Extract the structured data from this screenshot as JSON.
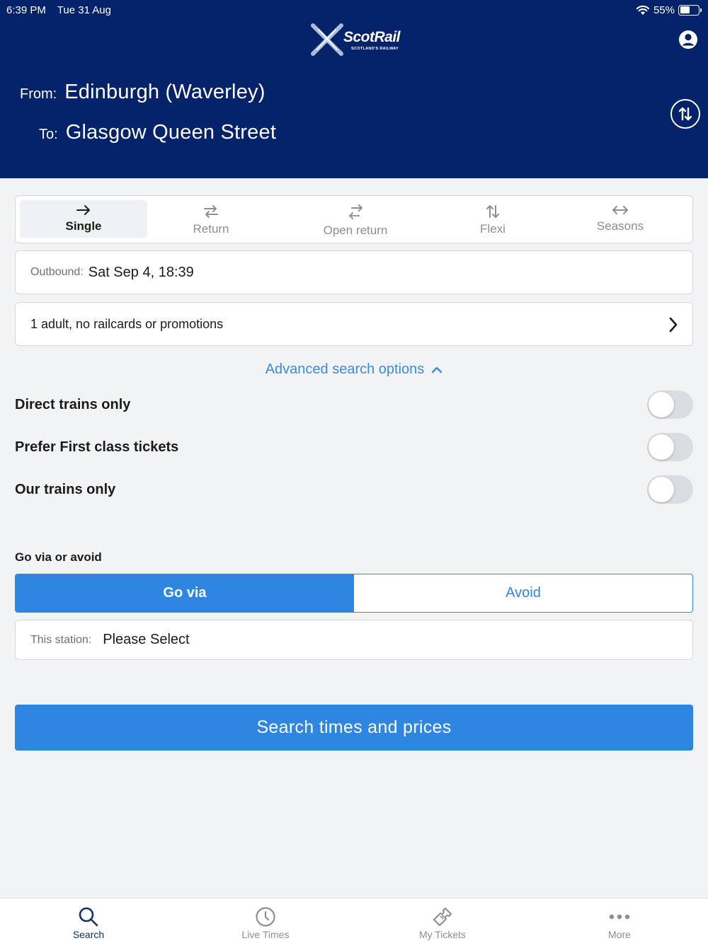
{
  "status_bar": {
    "time": "6:39 PM",
    "date": "Tue 31 Aug",
    "battery": "55%",
    "battery_level": 0.55
  },
  "brand": {
    "name": "ScotRail",
    "tagline": "SCOTLAND'S RAILWAY"
  },
  "journey": {
    "from_label": "From:",
    "from_value": "Edinburgh (Waverley)",
    "to_label": "To:",
    "to_value": "Glasgow Queen Street"
  },
  "ticket_types": [
    {
      "label": "Single",
      "icon": "arrow-right-icon",
      "active": true
    },
    {
      "label": "Return",
      "icon": "arrows-exchange-icon",
      "active": false
    },
    {
      "label": "Open return",
      "icon": "open-return-icon",
      "active": false
    },
    {
      "label": "Flexi",
      "icon": "arrows-up-down-icon",
      "active": false
    },
    {
      "label": "Seasons",
      "icon": "arrow-left-right-icon",
      "active": false
    }
  ],
  "outbound": {
    "label": "Outbound:",
    "value": "Sat Sep 4, 18:39"
  },
  "passengers": {
    "value": "1 adult, no railcards or promotions"
  },
  "advanced": {
    "label": "Advanced search options"
  },
  "toggles": [
    {
      "label": "Direct trains only",
      "on": false
    },
    {
      "label": "Prefer First class tickets",
      "on": false
    },
    {
      "label": "Our trains only",
      "on": false
    }
  ],
  "via": {
    "title": "Go via or avoid",
    "go_via": "Go via",
    "avoid": "Avoid",
    "selected": "Go via"
  },
  "station": {
    "label": "This station:",
    "value": "Please Select"
  },
  "search_button": "Search times and prices",
  "nav": [
    {
      "label": "Search",
      "icon": "search-icon",
      "active": true
    },
    {
      "label": "Live Times",
      "icon": "clock-icon",
      "active": false
    },
    {
      "label": "My Tickets",
      "icon": "ticket-icon",
      "active": false
    },
    {
      "label": "More",
      "icon": "more-dots-icon",
      "active": false
    }
  ],
  "colors": {
    "header": "#04236b",
    "accent": "#2e86e0",
    "link": "#3b8be0",
    "background": "#f2f3f5"
  }
}
